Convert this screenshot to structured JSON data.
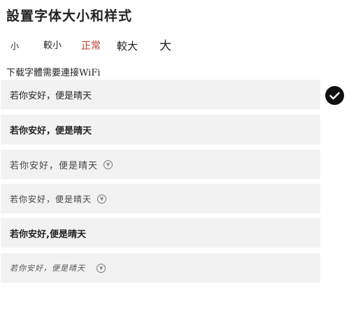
{
  "title": "設置字体大小和样式",
  "sizes": {
    "xs": "小",
    "s": "較小",
    "m": "正常",
    "l": "較大",
    "xl": "大"
  },
  "hint": "下载字體需要連接WiFi",
  "fonts": [
    {
      "sample": "若你安好，便是晴天",
      "paid": false,
      "selected": true
    },
    {
      "sample": "若你安好，便是晴天",
      "paid": false
    },
    {
      "sample": "若你安好，便是晴天",
      "paid": true,
      "badge": "¥"
    },
    {
      "sample": "若你安好，便是晴天",
      "paid": true,
      "badge": "¥"
    },
    {
      "sample": "若你安好,便是晴天",
      "paid": false
    },
    {
      "sample": "若你安好，便是晴天",
      "paid": true,
      "badge": "¥"
    }
  ],
  "colors": {
    "active": "#c0392b",
    "item_bg": "#f2f2f2",
    "check_bg": "#111111"
  },
  "icons": {
    "selected": "check-icon",
    "paid": "yen-coin-icon"
  }
}
